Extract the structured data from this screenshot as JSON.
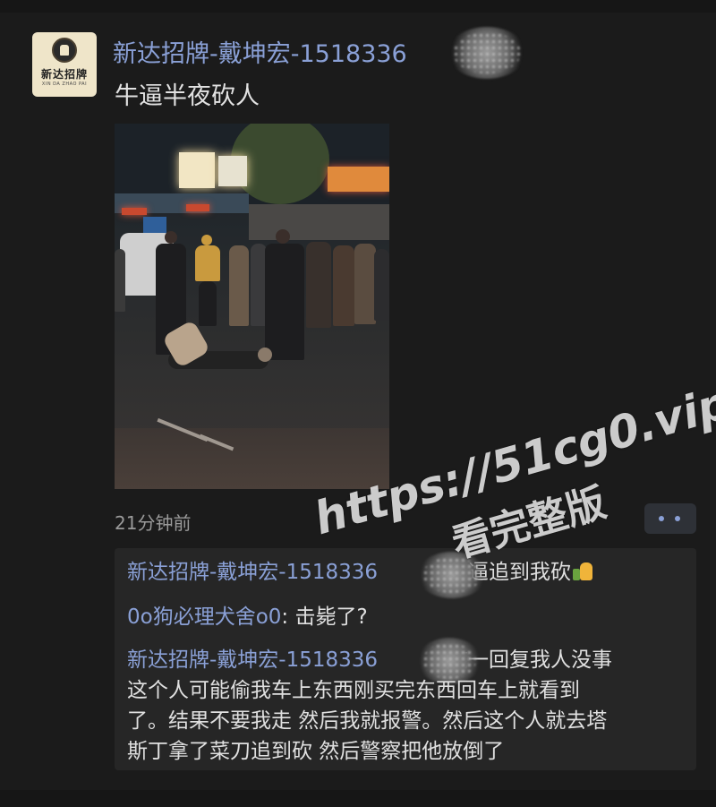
{
  "post": {
    "author_visible": "新达招牌-戴坤宏-1518336",
    "text": "牛逼半夜砍人",
    "time": "21分钟前",
    "avatar": {
      "logo_text": "新达招牌",
      "logo_sub": "XIN DA ZHAO PAI"
    }
  },
  "comments": [
    {
      "name": "新达招牌-戴坤宏-1518336",
      "text": "牛逼追到我砍",
      "emoji": "thumbs-up-icon"
    },
    {
      "name": "0o狗必理犬舍o0",
      "separator": ": ",
      "text": "击毙了?"
    },
    {
      "name": "新达招牌-戴坤宏-1518336",
      "text_lines": [
        "统一回复我人没事",
        "这个人可能偷我车上东西刚买完东西回车上就看到",
        "了。结果不要我走 然后我就报警。然后这个人就去塔",
        "斯丁拿了菜刀追到砍 然后警察把他放倒了"
      ]
    }
  ],
  "watermark": {
    "line1": "https://51cg0.vip",
    "line2": "看完整版"
  },
  "colors": {
    "background": "#1b1b1b",
    "name_link": "#8aa0d6",
    "comment_bg": "#262626"
  }
}
